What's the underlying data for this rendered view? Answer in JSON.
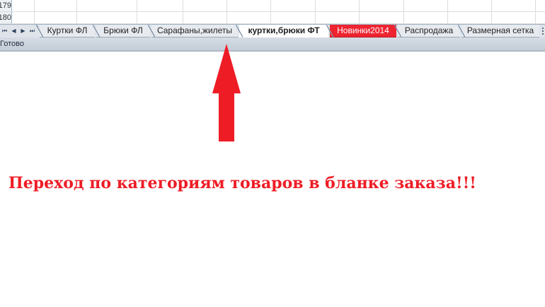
{
  "grid": {
    "rows": [
      "179",
      "180"
    ]
  },
  "nav": {
    "first": "⏮",
    "prev": "◀",
    "next": "▶",
    "last": "⏭"
  },
  "tabs": [
    {
      "label": "Куртки ФЛ"
    },
    {
      "label": "Брюки ФЛ"
    },
    {
      "label": "Сарафаны,жилеты"
    },
    {
      "label": "куртки,брюки ФТ"
    },
    {
      "label": "Новинки2014"
    },
    {
      "label": "Распродажа"
    },
    {
      "label": "Размерная сетка"
    }
  ],
  "status": {
    "text": "Готово"
  },
  "annotation": {
    "caption": "Переход по категориям товаров в бланке заказа!!!",
    "color": "#ee1c25"
  },
  "colors": {
    "new_tab": "#ee2431",
    "arrow": "#ee1c25"
  }
}
